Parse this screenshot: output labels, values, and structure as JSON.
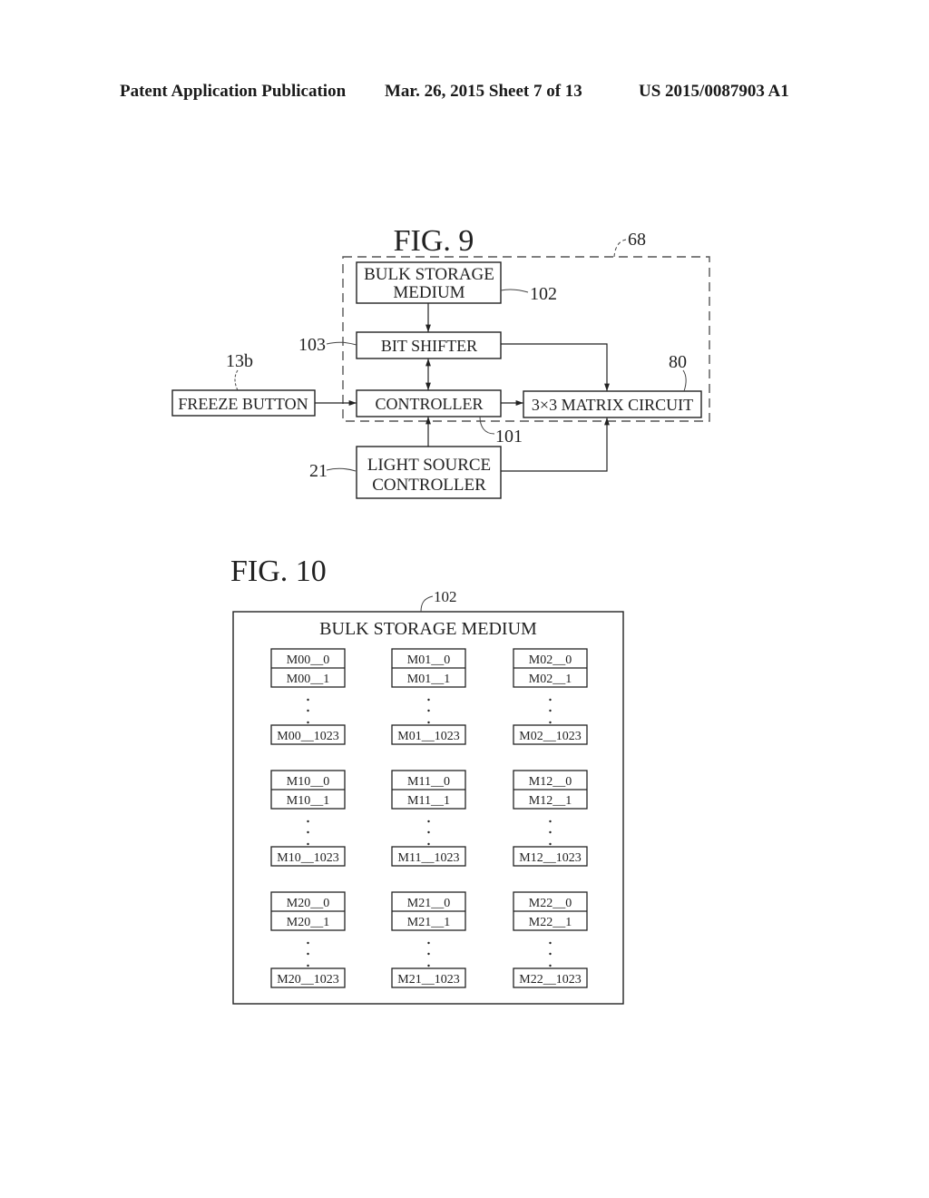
{
  "header": {
    "publication": "Patent Application Publication",
    "date_sheet": "Mar. 26, 2015  Sheet 7 of 13",
    "number": "US 2015/0087903 A1"
  },
  "fig9": {
    "title": "FIG. 9",
    "ref_enclosure": "68",
    "blocks": {
      "bulk_storage": {
        "line1": "BULK STORAGE",
        "line2": "MEDIUM",
        "ref": "102"
      },
      "bit_shifter": {
        "label": "BIT SHIFTER",
        "ref": "103"
      },
      "freeze_button": {
        "label": "FREEZE BUTTON",
        "ref": "13b"
      },
      "controller": {
        "label": "CONTROLLER",
        "ref": "101"
      },
      "matrix_circuit": {
        "label": "3×3 MATRIX CIRCUIT",
        "ref": "80"
      },
      "light_source": {
        "line1": "LIGHT SOURCE",
        "line2": "CONTROLLER",
        "ref": "21"
      }
    },
    "connections": [
      {
        "from": "bulk_storage",
        "to": "bit_shifter",
        "type": "arrow"
      },
      {
        "from": "bit_shifter",
        "to": "controller",
        "type": "bidirectional"
      },
      {
        "from": "bit_shifter",
        "to": "matrix_circuit",
        "type": "arrow"
      },
      {
        "from": "freeze_button",
        "to": "controller",
        "type": "arrow"
      },
      {
        "from": "controller",
        "to": "matrix_circuit",
        "type": "arrow"
      },
      {
        "from": "light_source",
        "to": "controller",
        "type": "arrow"
      },
      {
        "from": "light_source",
        "to": "matrix_circuit",
        "type": "arrow"
      }
    ]
  },
  "fig10": {
    "title": "FIG. 10",
    "ref": "102",
    "box_title": "BULK STORAGE MEDIUM",
    "groups": [
      [
        {
          "first": "M00__0",
          "second": "M00__1",
          "last": "M00__1023"
        },
        {
          "first": "M01__0",
          "second": "M01__1",
          "last": "M01__1023"
        },
        {
          "first": "M02__0",
          "second": "M02__1",
          "last": "M02__1023"
        }
      ],
      [
        {
          "first": "M10__0",
          "second": "M10__1",
          "last": "M10__1023"
        },
        {
          "first": "M11__0",
          "second": "M11__1",
          "last": "M11__1023"
        },
        {
          "first": "M12__0",
          "second": "M12__1",
          "last": "M12__1023"
        }
      ],
      [
        {
          "first": "M20__0",
          "second": "M20__1",
          "last": "M20__1023"
        },
        {
          "first": "M21__0",
          "second": "M21__1",
          "last": "M21__1023"
        },
        {
          "first": "M22__0",
          "second": "M22__1",
          "last": "M22__1023"
        }
      ]
    ]
  }
}
